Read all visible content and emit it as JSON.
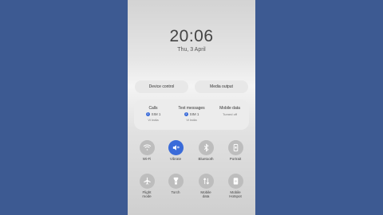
{
  "time": "20:06",
  "date": "Thu, 3 April",
  "buttons": {
    "device_control": "Device control",
    "media_output": "Media output"
  },
  "sim": [
    {
      "title": "Calls",
      "sim": "SIM 1",
      "carrier": "Vi India"
    },
    {
      "title": "Text messages",
      "sim": "SIM 1",
      "carrier": "Vi India"
    },
    {
      "title": "Mobile data",
      "status": "Turned off"
    }
  ],
  "sim_badge": "1",
  "tiles": [
    {
      "label": "Wi-Fi",
      "icon": "wifi-icon",
      "active": false
    },
    {
      "label": "Vibrate",
      "icon": "vibrate-icon",
      "active": true
    },
    {
      "label": "Bluetooth",
      "icon": "bluetooth-icon",
      "active": false
    },
    {
      "label": "Portrait",
      "icon": "portrait-icon",
      "active": false
    },
    {
      "label_line1": "Flight",
      "label_line2": "mode",
      "icon": "airplane-icon",
      "active": false
    },
    {
      "label": "Torch",
      "icon": "torch-icon",
      "active": false
    },
    {
      "label_line1": "Mobile",
      "label_line2": "data",
      "icon": "mobile-data-icon",
      "active": false
    },
    {
      "label_line1": "Mobile",
      "label_line2": "Hotspot",
      "icon": "hotspot-icon",
      "active": false
    }
  ],
  "colors": {
    "background": "#3d5a92",
    "accent": "#3a6bd9",
    "tile_inactive": "#bdbdbd"
  }
}
